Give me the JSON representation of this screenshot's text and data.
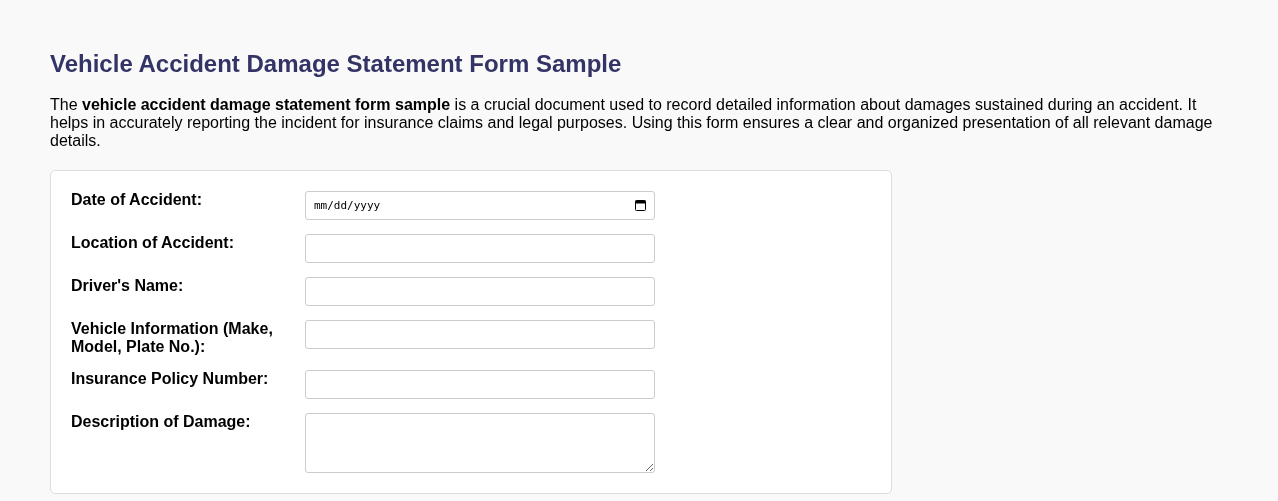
{
  "title": "Vehicle Accident Damage Statement Form Sample",
  "intro": "The **vehicle accident damage statement form sample** is a crucial document used to record detailed information about damages sustained during an accident. It helps in accurately reporting the incident for insurance claims and legal purposes. Using this form ensures a clear and organized presentation of all relevant damage details.",
  "fields": [
    {
      "label": "Date of Accident:",
      "kind": "date",
      "placeholder": "mm/dd/yyyy"
    },
    {
      "label": "Location of Accident:",
      "kind": "text"
    },
    {
      "label": "Driver's Name:",
      "kind": "text"
    },
    {
      "label": "Vehicle Information (Make, Model, Plate No.):",
      "kind": "text"
    },
    {
      "label": "Insurance Policy Number:",
      "kind": "text"
    },
    {
      "label": "Description of Damage:",
      "kind": "textarea"
    }
  ]
}
